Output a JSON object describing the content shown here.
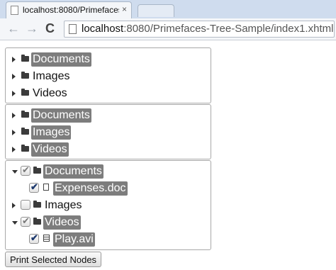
{
  "browser": {
    "tab_title": "localhost:8080/Primefaces",
    "tab_close": "×",
    "back": "←",
    "forward": "→",
    "reload": "C",
    "url_host": "localhost",
    "url_rest": ":8080/Primefaces-Tree-Sample/index1.xhtml"
  },
  "trees": [
    {
      "nodes": [
        {
          "label": "Documents",
          "icon": "folder",
          "state": "collapsed",
          "highlighted": true
        },
        {
          "label": "Images",
          "icon": "folder",
          "state": "collapsed",
          "highlighted": false
        },
        {
          "label": "Videos",
          "icon": "folder",
          "state": "collapsed",
          "highlighted": false
        }
      ]
    },
    {
      "nodes": [
        {
          "label": "Documents",
          "icon": "folder",
          "state": "collapsed",
          "highlighted": true
        },
        {
          "label": "Images",
          "icon": "folder",
          "state": "collapsed",
          "highlighted": true
        },
        {
          "label": "Videos",
          "icon": "folder",
          "state": "collapsed",
          "highlighted": true
        }
      ]
    },
    {
      "nodes": [
        {
          "label": "Documents",
          "icon": "folder",
          "state": "expanded",
          "highlighted": true,
          "checkbox": "partial"
        },
        {
          "label": "Expenses.doc",
          "icon": "document",
          "highlighted": true,
          "checkbox": "checked"
        },
        {
          "label": "Images",
          "icon": "folder",
          "state": "collapsed",
          "highlighted": false,
          "checkbox": "unchecked"
        },
        {
          "label": "Videos",
          "icon": "folder",
          "state": "expanded",
          "highlighted": true,
          "checkbox": "partial"
        },
        {
          "label": "Play.avi",
          "icon": "video",
          "highlighted": true,
          "checkbox": "checked"
        }
      ]
    }
  ],
  "check_glyph": "✔",
  "print_button": "Print Selected Nodes"
}
